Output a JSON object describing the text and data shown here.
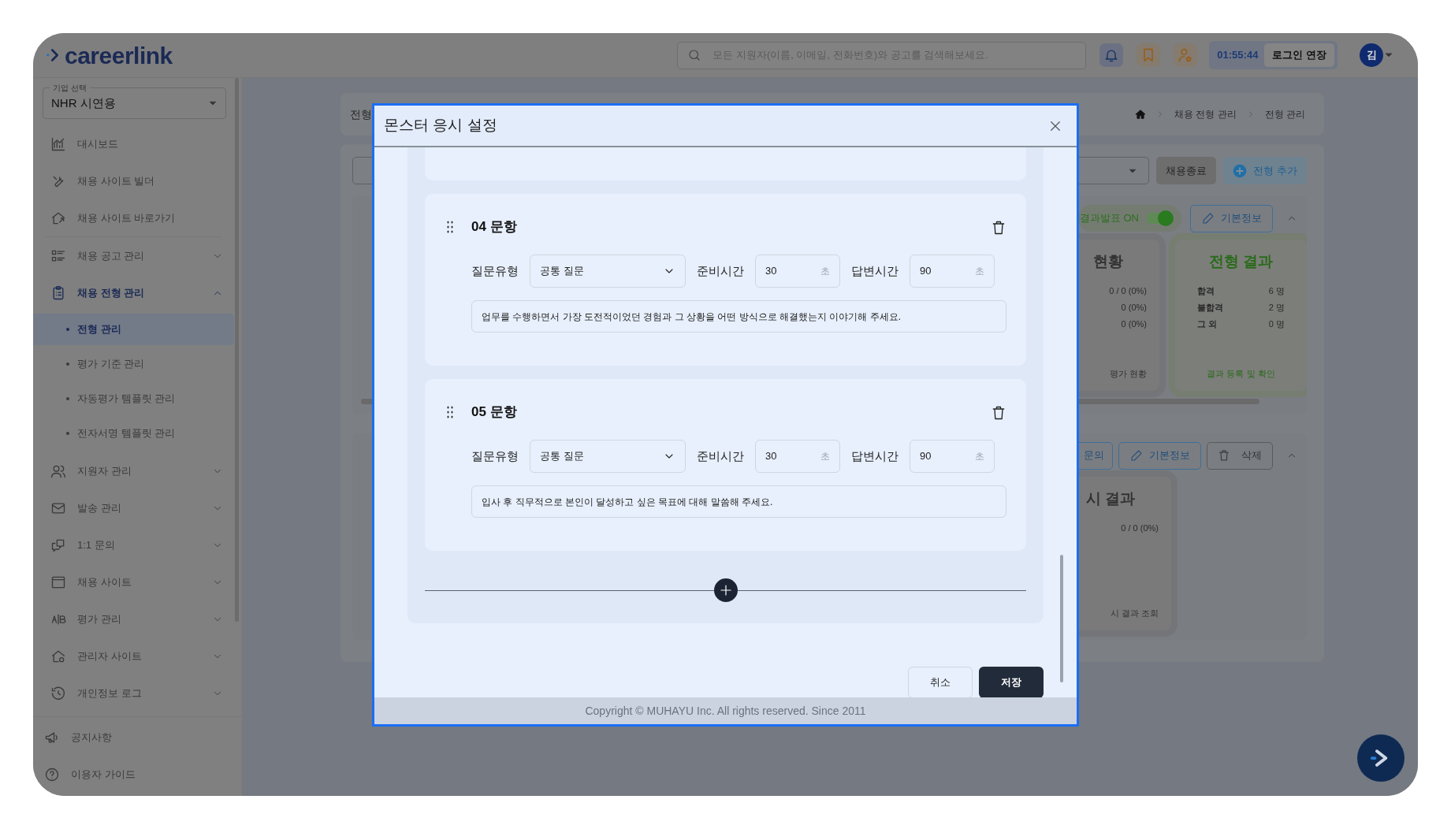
{
  "header": {
    "logo": "careerlink",
    "search": {
      "placeholder": "모든 지원자(이름, 이메일, 전화번호)와 공고를 검색해보세요."
    },
    "timer": "01:55:44",
    "extend_button": "로그인 연장",
    "avatar": "김"
  },
  "sidebar": {
    "company_select": {
      "label": "기업 선택",
      "value": "NHR 시연용"
    },
    "items": [
      {
        "kind": "link",
        "label": "대시보드",
        "selected": false
      },
      {
        "kind": "link",
        "label": "채용 사이트 빌더",
        "selected": false
      },
      {
        "kind": "link",
        "label": "채용 사이트 바로가기",
        "selected": false
      },
      {
        "kind": "divider"
      },
      {
        "kind": "group",
        "label": "채용 공고 관리",
        "selected": false,
        "expanded": false
      },
      {
        "kind": "group",
        "label": "채용 전형 관리",
        "selected": true,
        "expanded": true,
        "children": [
          {
            "label": "전형 관리",
            "selected": true
          },
          {
            "label": "평가 기준 관리",
            "selected": false
          },
          {
            "label": "자동평가 템플릿 관리",
            "selected": false
          },
          {
            "label": "전자서명 템플릿 관리",
            "selected": false
          }
        ]
      },
      {
        "kind": "group",
        "label": "지원자 관리",
        "selected": false,
        "expanded": false
      },
      {
        "kind": "group",
        "label": "발송 관리",
        "selected": false,
        "expanded": false
      },
      {
        "kind": "group",
        "label": "1:1 문의",
        "selected": false,
        "expanded": false
      },
      {
        "kind": "group",
        "label": "채용 사이트",
        "selected": false,
        "expanded": false
      },
      {
        "kind": "group",
        "label": "평가 관리",
        "selected": false,
        "expanded": false
      },
      {
        "kind": "group",
        "label": "관리자 사이트",
        "selected": false,
        "expanded": false
      },
      {
        "kind": "group",
        "label": "개인정보 로그",
        "selected": false,
        "expanded": false
      }
    ],
    "footer_items": [
      {
        "label": "공지사항"
      },
      {
        "label": "이용자 가이드"
      }
    ]
  },
  "page": {
    "title": "전형",
    "breadcrumb": [
      "채용 전형 관리",
      "전형 관리"
    ],
    "end_button": "채용종료",
    "add_button": "전형 추가",
    "stages": [
      {
        "toggle": {
          "label": "결과발표 ON",
          "on": true
        },
        "buttons": [
          {
            "kind": "edit",
            "label": "기본정보"
          }
        ],
        "cards": [
          {
            "kind": "plain",
            "title": "현황",
            "rows": [
              {
                "value": "0 / 0 (0%)"
              },
              {
                "value": "0 (0%)"
              },
              {
                "value": "0 (0%)"
              }
            ],
            "link": "평가 현황"
          },
          {
            "kind": "result",
            "title": "전형 결과",
            "rows": [
              {
                "label": "합격",
                "value": "6 명"
              },
              {
                "label": "불합격",
                "value": "2 명"
              },
              {
                "label": "그 외",
                "value": "0 명"
              }
            ],
            "link": "결과 등록 및 확인"
          }
        ]
      },
      {
        "buttons": [
          {
            "kind": "outline",
            "label": "문의"
          },
          {
            "kind": "edit",
            "label": "기본정보"
          },
          {
            "kind": "delete",
            "label": "삭제"
          }
        ],
        "cards": [
          {
            "kind": "plain",
            "title": "시 결과",
            "rows": [
              {
                "value": "0 / 0 (0%)"
              }
            ],
            "link": "시 결과 조회"
          }
        ]
      }
    ]
  },
  "modal": {
    "title": "몬스터 응시 설정",
    "questions": [
      {
        "title": "04 문항",
        "type_label": "질문유형",
        "type_value": "공통 질문",
        "prep_label": "준비시간",
        "prep_value": "30",
        "prep_unit": "초",
        "answer_label": "답변시간",
        "answer_value": "90",
        "answer_unit": "초",
        "question": "업무를 수행하면서 가장 도전적이었던 경험과 그 상황을 어떤 방식으로 해결했는지 이야기해 주세요."
      },
      {
        "title": "05 문항",
        "type_label": "질문유형",
        "type_value": "공통 질문",
        "prep_label": "준비시간",
        "prep_value": "30",
        "prep_unit": "초",
        "answer_label": "답변시간",
        "answer_value": "90",
        "answer_unit": "초",
        "question": "입사 후 직무적으로 본인이 달성하고 싶은 목표에 대해 말씀해 주세요."
      }
    ],
    "cancel_button": "취소",
    "save_button": "저장",
    "footer": "Copyright © MUHAYU Inc. All rights reserved. Since 2011"
  }
}
